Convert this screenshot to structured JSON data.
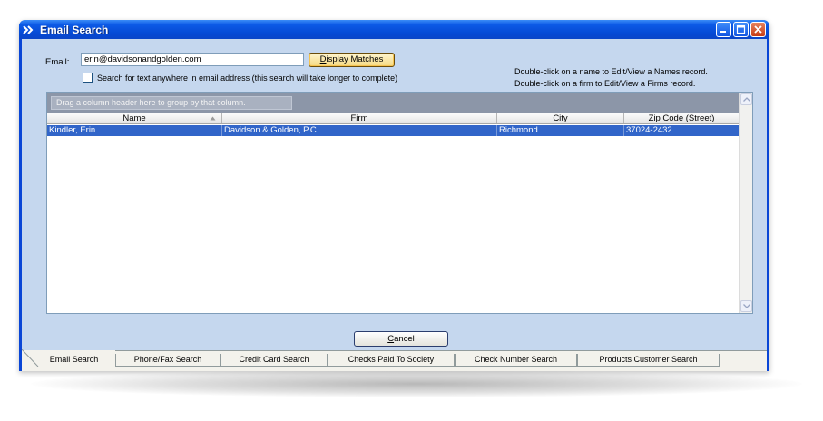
{
  "window": {
    "title": "Email Search"
  },
  "form": {
    "email_label": "Email:",
    "email_value": "erin@davidsonandgolden.com",
    "display_button_prefix": "",
    "display_button_mnemonic": "D",
    "display_button_rest": "isplay Matches",
    "search_anywhere_label": "Search for text anywhere in email address (this search will take longer to complete)",
    "search_anywhere_checked": false,
    "hint_names": "Double-click on a name to Edit/View a Names record.",
    "hint_firms": "Double-click on a firm to Edit/View a Firms record."
  },
  "grid": {
    "group_hint": "Drag a column header here to group by that column.",
    "columns": [
      "Name",
      "Firm",
      "City",
      "Zip Code (Street)"
    ],
    "sort_column": "Name",
    "rows": [
      {
        "name": "Kindler, Erin",
        "firm": "Davidson & Golden, P.C.",
        "city": "Richmond",
        "zip": "37024-2432",
        "selected": true
      }
    ]
  },
  "actions": {
    "cancel_mnemonic": "C",
    "cancel_rest": "ancel"
  },
  "tabs": [
    {
      "label": "Email Search",
      "active": true
    },
    {
      "label": "Phone/Fax Search",
      "active": false
    },
    {
      "label": "Credit Card Search",
      "active": false
    },
    {
      "label": "Checks Paid To Society",
      "active": false
    },
    {
      "label": "Check Number Search",
      "active": false
    },
    {
      "label": "Products Customer Search",
      "active": false
    }
  ],
  "colors": {
    "title_bar": "#0548d3",
    "panel": "#c5d7ee",
    "group_area": "#8c96a8",
    "selection": "#3165c9",
    "display_button": "#f5d880"
  },
  "icons": {
    "title": "double-arrow-icon",
    "sort": "sort-ascending-icon",
    "minimize": "minimize-icon",
    "maximize": "maximize-icon",
    "close": "close-icon",
    "scroll_up": "chevron-up-icon",
    "scroll_down": "chevron-down-icon"
  }
}
